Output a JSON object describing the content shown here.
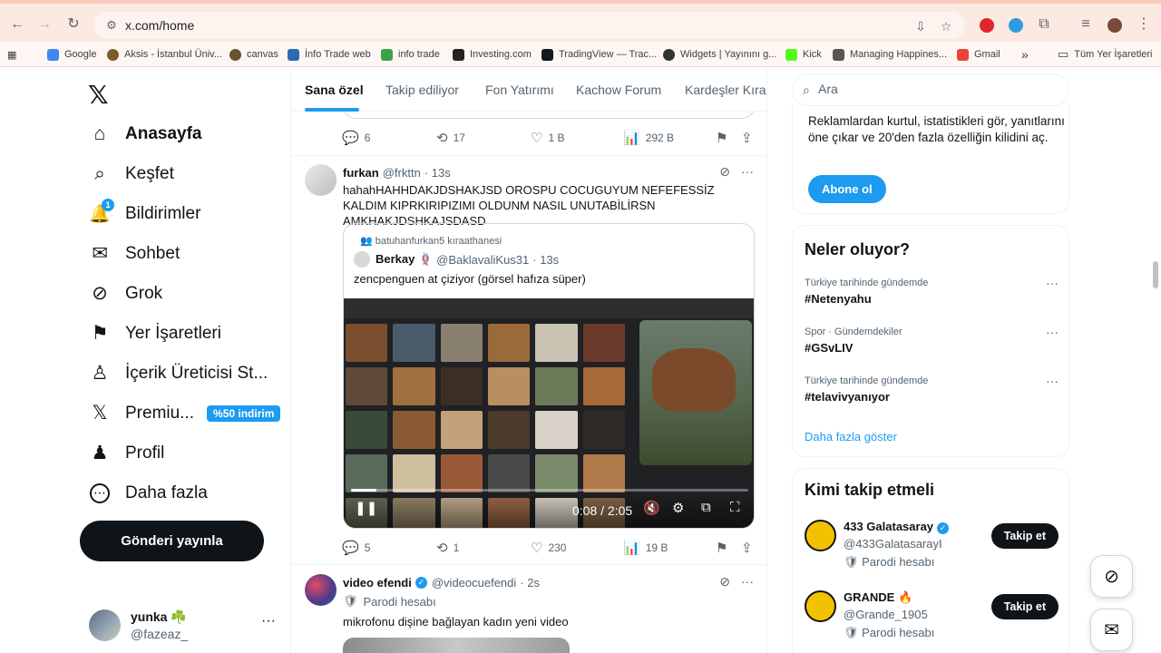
{
  "browser": {
    "url": "x.com/home",
    "bookmarks": [
      {
        "label": "Google",
        "color": "#4285f4"
      },
      {
        "label": "Aksis - İstanbul Üniv...",
        "color": "#7a5c2e"
      },
      {
        "label": "canvas",
        "color": "#6b5330"
      },
      {
        "label": "İnfo Trade web",
        "color": "#2b6cb0"
      },
      {
        "label": "info trade",
        "color": "#3aa14b"
      },
      {
        "label": "Investing.com",
        "color": "#222222"
      },
      {
        "label": "TradingView — Trac...",
        "color": "#131722"
      },
      {
        "label": "Widgets | Yayınını g...",
        "color": "#333333"
      },
      {
        "label": "Kick",
        "color": "#53fc18"
      },
      {
        "label": "Managing Happines...",
        "color": "#555555"
      },
      {
        "label": "Gmail",
        "color": "#ea4335"
      }
    ],
    "bookmarks_overflow": "»",
    "all_bookmarks": "Tüm Yer İşaretleri"
  },
  "sidebar": {
    "items": [
      {
        "label": "Anasayfa",
        "icon": "home-icon",
        "glyph": "⌂"
      },
      {
        "label": "Keşfet",
        "icon": "search-icon",
        "glyph": "⌕"
      },
      {
        "label": "Bildirimler",
        "icon": "bell-icon",
        "glyph": "🔔",
        "badge": "1"
      },
      {
        "label": "Sohbet",
        "icon": "mail-icon",
        "glyph": "✉"
      },
      {
        "label": "Grok",
        "icon": "grok-icon",
        "glyph": "⊘"
      },
      {
        "label": "Yer İşaretleri",
        "icon": "bookmark-icon",
        "glyph": "⚑"
      },
      {
        "label": "İçerik Üreticisi St...",
        "icon": "creator-icon",
        "glyph": "♙"
      },
      {
        "label": "Premiu...",
        "icon": "x-premium-icon",
        "glyph": "𝕏",
        "tag": "%50 indirim"
      },
      {
        "label": "Profil",
        "icon": "profile-icon",
        "glyph": "♟"
      },
      {
        "label": "Daha fazla",
        "icon": "more-circle-icon",
        "glyph": "⋯"
      }
    ],
    "post_button": "Gönderi yayınla",
    "account": {
      "name": "yunka ☘️",
      "handle": "@fazeaz_",
      "more": "···"
    }
  },
  "timeline": {
    "tabs": [
      "Sana özel",
      "Takip ediliyor",
      "Fon Yatırımı",
      "Kachow Forum",
      "Kardeşler Kıraat"
    ],
    "prev_tweet_stats": {
      "replies": "6",
      "reposts": "17",
      "likes": "1 B",
      "views": "292 B"
    },
    "tweet1": {
      "name": "furkan",
      "handle": "@frkttn",
      "time": "· 13s",
      "text": "hahahHAHHDAKJDSHAKJSD OROSPU COCUGUYUM NEFEFESSİZ KALDIM KIPRKIRIPIZIMI OLDUNM NASIL UNUTABİLİRSN AMKHAKJDSHKAJSDASD",
      "quote": {
        "community": "batuhanfurkan5 kıraathanesi",
        "name": "Berkay 🪢",
        "handle": "@BaklavaliKus31",
        "time": "· 13s",
        "text": "zencpenguen at çiziyor (görsel hafıza süper)",
        "video_time": "0:08 / 2:05",
        "video_progress": 0.064
      },
      "stats": {
        "replies": "5",
        "reposts": "1",
        "likes": "230",
        "views": "19 B"
      }
    },
    "tweet2": {
      "name": "video efendi",
      "handle": "@videocuefendi",
      "time": "· 2s",
      "parody": "Parodi hesabı",
      "text": "mikrofonu dişine bağlayan kadın yeni video"
    }
  },
  "right": {
    "search_placeholder": "Ara",
    "promo": "Reklamlardan kurtul, istatistikleri gör, yanıtlarını öne çıkar ve 20'den fazla özelliğin kilidini aç.",
    "subscribe": "Abone ol",
    "trends_title": "Neler oluyor?",
    "trends": [
      {
        "category": "Türkiye tarihinde gündemde",
        "tag": "#Netenyahu"
      },
      {
        "category": "Spor · Gündemdekiler",
        "tag": "#GSvLIV"
      },
      {
        "category": "Türkiye tarihinde gündemde",
        "tag": "#telavivyanıyor"
      }
    ],
    "show_more": "Daha fazla göster",
    "who_title": "Kimi takip etmeli",
    "who": [
      {
        "name": "433 Galatasaray",
        "handle": "@433GalatasarayI",
        "parody": "Parodi hesabı",
        "follow": "Takip et",
        "verified": true
      },
      {
        "name": "GRANDE 🔥",
        "handle": "@Grande_1905",
        "parody": "Parodi hesabı",
        "follow": "Takip et",
        "verified": false
      }
    ]
  },
  "colors": {
    "accent": "#1d9bf0",
    "text": "#0f1419",
    "muted": "#536471"
  }
}
